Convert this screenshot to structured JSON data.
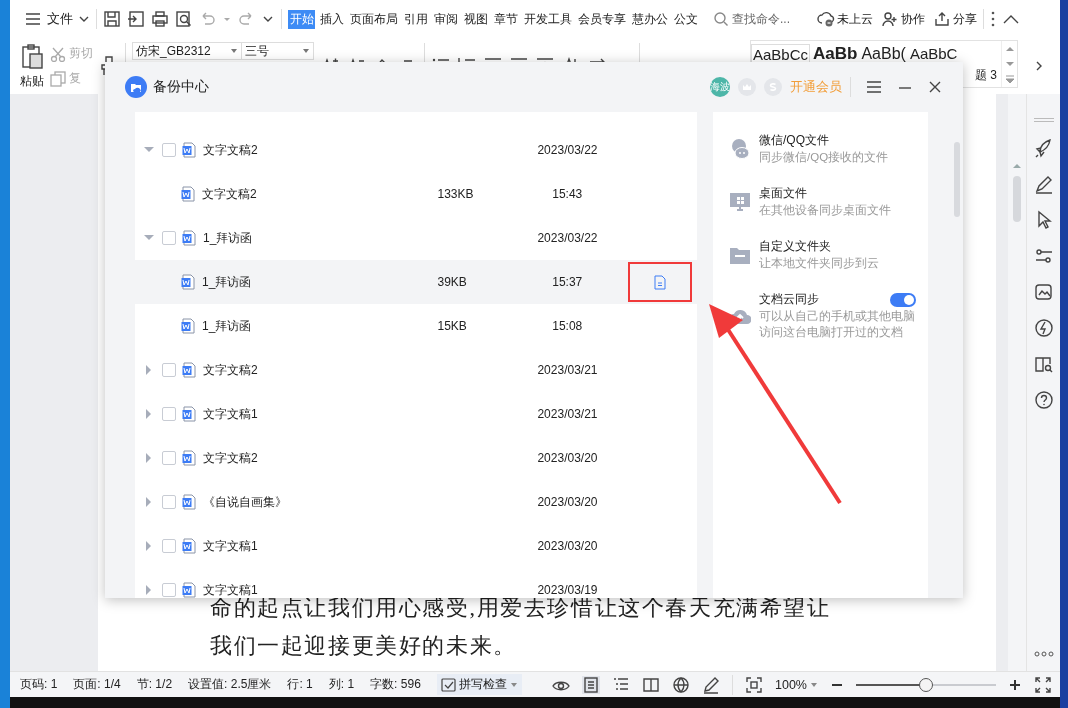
{
  "app_menu": {
    "label": "文件"
  },
  "ribbon_tabs": [
    {
      "label": "开始",
      "selected": true
    },
    {
      "label": "插入",
      "selected": false
    },
    {
      "label": "页面布局",
      "selected": false
    },
    {
      "label": "引用",
      "selected": false
    },
    {
      "label": "审阅",
      "selected": false
    },
    {
      "label": "视图",
      "selected": false
    },
    {
      "label": "章节",
      "selected": false
    },
    {
      "label": "开发工具",
      "selected": false
    },
    {
      "label": "会员专享",
      "selected": false
    },
    {
      "label": "慧办公",
      "selected": false
    },
    {
      "label": "公文",
      "selected": false
    }
  ],
  "search": {
    "placeholder": "查找命令..."
  },
  "top_actions": [
    {
      "label": "未上云",
      "kind": "cloud"
    },
    {
      "label": "协作",
      "kind": "collab"
    },
    {
      "label": "分享",
      "kind": "share"
    }
  ],
  "clipboard": {
    "paste": "粘贴",
    "cut": "剪切",
    "copy": "复"
  },
  "font": {
    "name": "仿宋_GB2312",
    "size": "三号"
  },
  "styles_gallery": [
    {
      "label": "AaBbCc",
      "kind": "normal"
    },
    {
      "label": "AaBb",
      "kind": "heading1"
    },
    {
      "label": "AaBb(",
      "kind": "heading2"
    },
    {
      "label": "AaBbC",
      "kind": "heading3"
    }
  ],
  "style_caption": "题 3",
  "document": {
    "lines": [
      "命的起点让我们用心感受,用爱去珍惜让这个春天充满希望让",
      "我们一起迎接更美好的未来。"
    ]
  },
  "dialog": {
    "title": "备份中心",
    "avatar": "海波",
    "vip": "开通会员",
    "files": [
      {
        "name": "文字文稿2",
        "date": "2023/03/22",
        "expanded": true,
        "checked": false,
        "selected": false,
        "children": [
          {
            "name": "文字文稿2",
            "size": "133KB",
            "time": "15:43",
            "selected": false
          }
        ]
      },
      {
        "name": "1_拜访函",
        "date": "2023/03/22",
        "expanded": true,
        "checked": false,
        "selected": false,
        "children": [
          {
            "name": "1_拜访函",
            "size": "39KB",
            "time": "15:37",
            "selected": true
          },
          {
            "name": "1_拜访函",
            "size": "15KB",
            "time": "15:08",
            "selected": false
          }
        ]
      },
      {
        "name": "文字文稿2",
        "date": "2023/03/21",
        "expanded": false,
        "checked": false,
        "selected": false
      },
      {
        "name": "文字文稿1",
        "date": "2023/03/21",
        "expanded": false,
        "checked": false,
        "selected": false
      },
      {
        "name": "文字文稿2",
        "date": "2023/03/20",
        "expanded": false,
        "checked": false,
        "selected": false
      },
      {
        "name": "《自说自画集》",
        "date": "2023/03/20",
        "expanded": false,
        "checked": false,
        "selected": false
      },
      {
        "name": "文字文稿1",
        "date": "2023/03/20",
        "expanded": false,
        "checked": false,
        "selected": false
      },
      {
        "name": "文字文稿1",
        "date": "2023/03/19",
        "expanded": false,
        "checked": false,
        "selected": false
      }
    ],
    "sync_options": [
      {
        "title": "微信/QQ文件",
        "description": "同步微信/QQ接收的文件",
        "kind": "chat"
      },
      {
        "title": "桌面文件",
        "description": "在其他设备同步桌面文件",
        "kind": "desktop"
      },
      {
        "title": "自定义文件夹",
        "description": "让本地文件夹同步到云",
        "kind": "folder"
      },
      {
        "title": "文档云同步",
        "description": "可以从自己的手机或其他电脑访问这台电脑打开过的文档",
        "kind": "cloud",
        "on": true
      }
    ]
  },
  "status_bar": {
    "items": [
      "页码: 1",
      "页面: 1/4",
      "节: 1/2",
      "设置值: 2.5厘米",
      "行: 1",
      "列: 1",
      "字数: 596"
    ],
    "spell_check": "拼写检查",
    "zoom": "100%",
    "zoom_slider": {
      "level": 0.5
    }
  }
}
